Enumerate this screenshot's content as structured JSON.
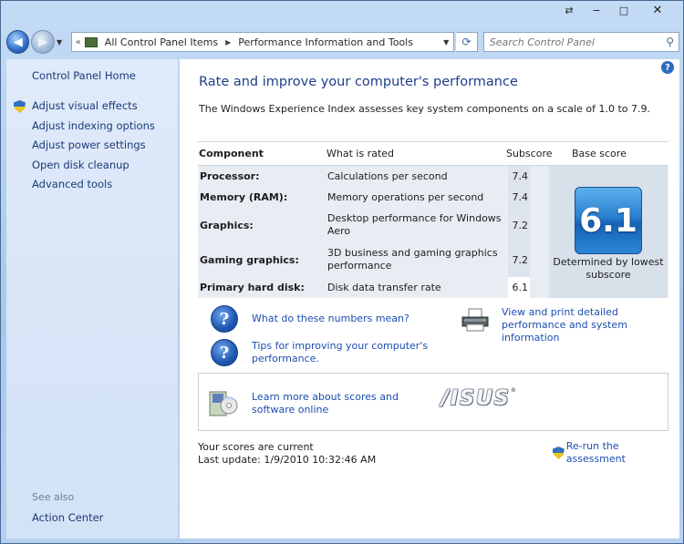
{
  "window": {
    "caption_restore": "⇄",
    "caption_min": "−",
    "caption_max": "□",
    "caption_close": "✕"
  },
  "address_bar": {
    "crumbs": [
      "All Control Panel Items",
      "Performance Information and Tools"
    ],
    "search_placeholder": "Search Control Panel"
  },
  "left_pane": {
    "home_link": "Control Panel Home",
    "tasks": [
      "Adjust visual effects",
      "Adjust indexing options",
      "Adjust power settings",
      "Open disk cleanup",
      "Advanced tools"
    ],
    "see_also_label": "See also",
    "see_also_links": [
      "Action Center"
    ]
  },
  "main": {
    "title": "Rate and improve your computer's performance",
    "intro": "The Windows Experience Index assesses key system components on a scale of 1.0 to 7.9.",
    "table": {
      "headers": [
        "Component",
        "What is rated",
        "Subscore",
        "Base score"
      ],
      "rows": [
        {
          "component": "Processor:",
          "rated": "Calculations per second",
          "subscore": "7.4"
        },
        {
          "component": "Memory (RAM):",
          "rated": "Memory operations per second",
          "subscore": "7.4"
        },
        {
          "component": "Graphics:",
          "rated": "Desktop performance for Windows Aero",
          "subscore": "7.2"
        },
        {
          "component": "Gaming graphics:",
          "rated": "3D business and gaming graphics performance",
          "subscore": "7.2"
        },
        {
          "component": "Primary hard disk:",
          "rated": "Disk data transfer rate",
          "subscore": "6.1"
        }
      ],
      "base_score": "6.1",
      "base_caption": "Determined by lowest subscore"
    },
    "links": {
      "what_mean": "What do these numbers mean?",
      "tips": "Tips for improving your computer's performance.",
      "print": "View and print detailed performance and system information",
      "learn": "Learn more about scores and software online"
    },
    "oem_logo": "/ISUS",
    "status_line1": "Your scores are current",
    "status_line2": "Last update: 1/9/2010 10:32:46 AM",
    "rerun": "Re-run the assessment"
  }
}
